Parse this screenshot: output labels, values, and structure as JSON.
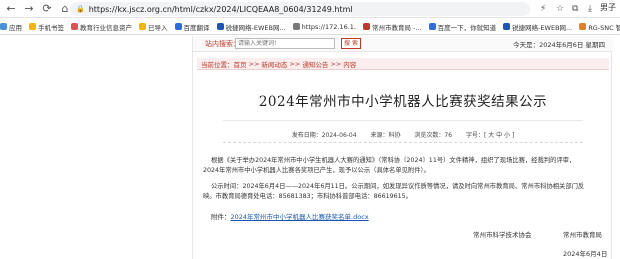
{
  "browser": {
    "url": "https://kx.jscz.org.cn/html/czkx/2024/LICQEAA8_0604/31249.html",
    "user": "男子"
  },
  "bookmarks": [
    {
      "label": "应用",
      "color": "#4a90d9"
    },
    {
      "label": "手机书签",
      "color": "#f5b400"
    },
    {
      "label": "教育行业信息资产",
      "color": "#e45050"
    },
    {
      "label": "已导入",
      "color": "#f5b400"
    },
    {
      "label": "百度翻译",
      "color": "#2b6de0"
    },
    {
      "label": "锐捷网络-EWEB网...",
      "color": "#1a56b8"
    },
    {
      "label": "https://172.16.1.",
      "color": "#7a7a7a"
    },
    {
      "label": "常州市教育局 -...",
      "color": "#c0392b"
    },
    {
      "label": "百度一下，你就知道",
      "color": "#2b6de0"
    },
    {
      "label": "锐捷网络-EWEB网...",
      "color": "#1a56b8"
    },
    {
      "label": "RG-SNC 智能网络...",
      "color": "#e67e22"
    },
    {
      "label": "常州市武进区教育...",
      "color": "#c0392b"
    },
    {
      "label": "IT 设",
      "color": "#7a7a7a"
    }
  ],
  "site": {
    "search_label": "站内搜索：",
    "search_placeholder": "请输入关键词!",
    "search_button": "搜 索",
    "today": "今天是：2024年6月6日 星期四",
    "breadcrumb": [
      "当前位置：首页",
      "新闻动态",
      "通知公告",
      "内容"
    ],
    "breadcrumb_sep": ">>"
  },
  "article": {
    "title": "2024年常州市中小学机器人比赛获奖结果公示",
    "publish_date": "发布日期：2024-06-04",
    "source": "来源：科协",
    "views": "浏览次数：76",
    "font_size": "字号：[ 大 中 小 ]",
    "para1_line1": "根据《关于举办2024年常州市中小学生机器人大赛的通知》（常科协〔2024〕11号）文件精神，组织了现场比赛，经裁判的评审，",
    "para1_line2": "2024年常州市中小学机器人比赛各奖项已产生，现予以公示（具体名单见附件）。",
    "para2_line1": "公示时间：2024年6月4日——2024年6月11日。公示期间，如发现异议作质等情况，请及时向常州市教育局、常州市科协相关部门反",
    "para2_line2": "映。市教育局德育处电话：85681383；市科协科普部电话：86619615。",
    "attach_label": "附件：",
    "attach_link": "2024年常州市中小学机器人比赛获奖名单.docx",
    "sign_org1": "常州市科学技术协会",
    "sign_org2": "常州市教育局",
    "sign_date": "2024年6月4日"
  }
}
